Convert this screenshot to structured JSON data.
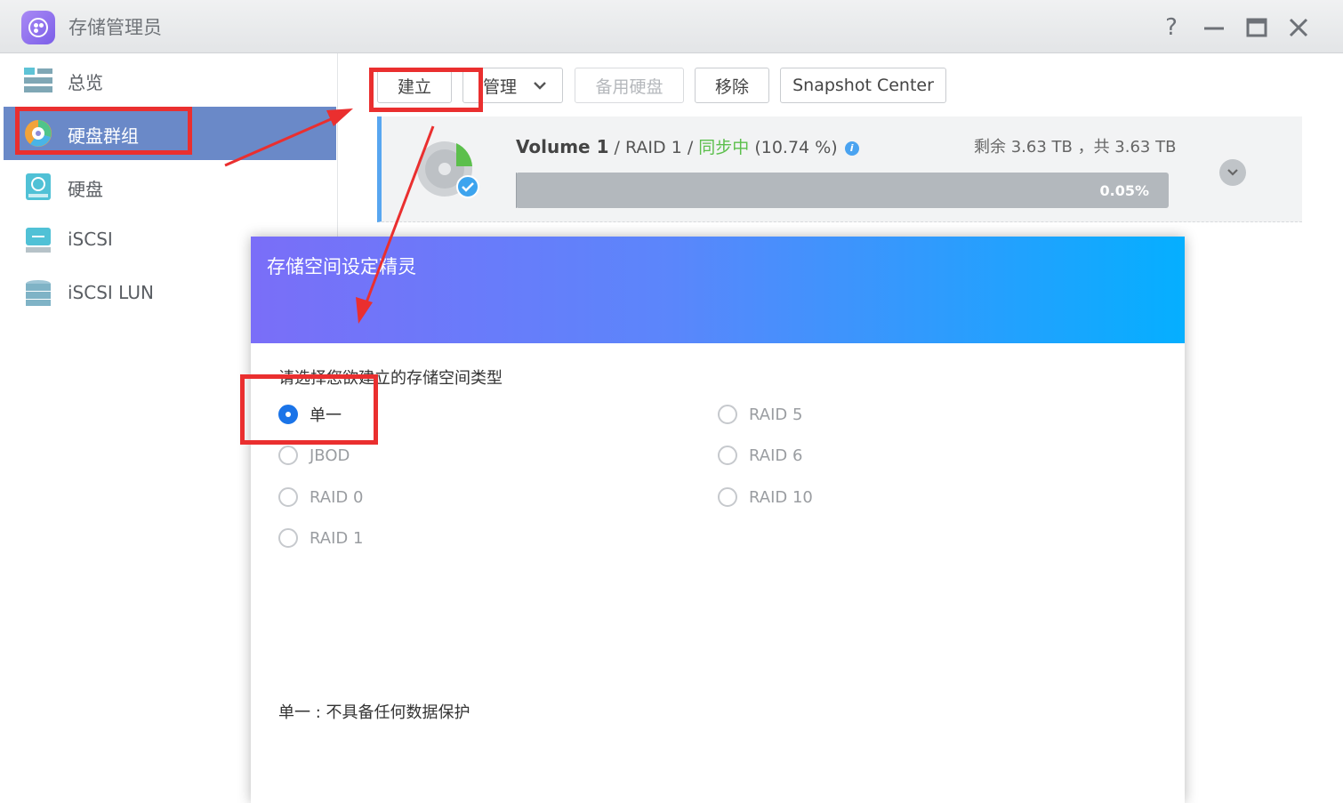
{
  "window": {
    "title": "存储管理员",
    "controls": {
      "help": "?",
      "minimize": "—",
      "maximize": "☐",
      "close": "✕"
    }
  },
  "sidebar": {
    "items": [
      {
        "label": "总览",
        "icon": "overview-icon",
        "active": false
      },
      {
        "label": "硬盘群组",
        "icon": "disk-group-icon",
        "active": true
      },
      {
        "label": "硬盘",
        "icon": "disk-icon",
        "active": false
      },
      {
        "label": "iSCSI",
        "icon": "iscsi-icon",
        "active": false
      },
      {
        "label": "iSCSI LUN",
        "icon": "iscsi-lun-icon",
        "active": false
      }
    ]
  },
  "toolbar": {
    "create": "建立",
    "manage": "管理",
    "spare_disk": "备用硬盘",
    "remove": "移除",
    "snapshot": "Snapshot Center"
  },
  "volume": {
    "name": "Volume 1",
    "sep1": " / ",
    "raid": "RAID 1",
    "sep2": " / ",
    "status": "同步中",
    "sync_percent": "(10.74 %)",
    "capacity": "剩余 3.63 TB ，共 3.63 TB",
    "usage_text": "0.05%",
    "usage_fraction": 0.0005
  },
  "dialog": {
    "title": "存储空间设定精灵",
    "prompt": "请选择您欲建立的存储空间类型",
    "options": [
      {
        "label": "单一",
        "checked": true
      },
      {
        "label": "JBOD",
        "checked": false
      },
      {
        "label": "RAID 0",
        "checked": false
      },
      {
        "label": "RAID 1",
        "checked": false
      },
      {
        "label": "RAID 5",
        "checked": false
      },
      {
        "label": "RAID 6",
        "checked": false
      },
      {
        "label": "RAID 10",
        "checked": false
      }
    ],
    "description": "单一 : 不具备任何数据保护"
  },
  "colors": {
    "accent": "#1b74e8",
    "sidebar_active": "#6a89c8",
    "sync_green": "#5cbf4c",
    "annotation_red": "#ea2f2f"
  }
}
